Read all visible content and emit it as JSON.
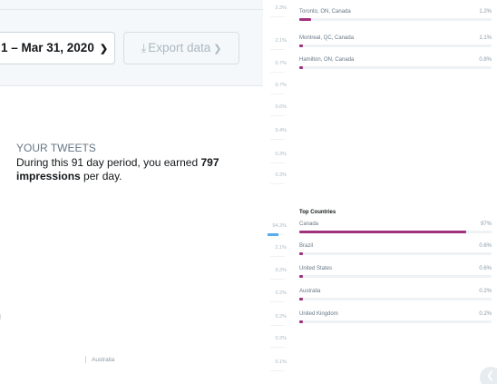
{
  "date_range": {
    "label": "1 – Mar 31, 2020"
  },
  "export": {
    "label": "Export data"
  },
  "tweets": {
    "heading": "YOUR TWEETS",
    "sentence_before": "During this 91 day period, you earned ",
    "impressions_value": "797",
    "impressions_word": "impressions",
    "sentence_after": " per day."
  },
  "left_chart_label": "Australia",
  "percent_column": [
    "2.3%",
    "2.1%",
    "0.7%",
    "0.7%",
    "0.6%",
    "0.4%",
    "0.3%",
    "0.3%",
    "94.3%",
    "2.1%",
    "0.2%",
    "0.2%",
    "0.2%",
    "0.2%",
    "0.1%"
  ],
  "top_cities": [
    {
      "name": "Toronto, ON, Canada",
      "value": "1.2%",
      "fraction": 0.06
    },
    {
      "name": "Montreal, QC, Canada",
      "value": "1.1%",
      "fraction": 0.02
    },
    {
      "name": "Hamilton, ON, Canada",
      "value": "0.8%",
      "fraction": 0.02
    }
  ],
  "top_countries": {
    "title": "Top Countries",
    "items": [
      {
        "name": "Canada",
        "value": "97%",
        "fraction": 0.87
      },
      {
        "name": "Brazil",
        "value": "0.6%",
        "fraction": 0.02
      },
      {
        "name": "United States",
        "value": "0.6%",
        "fraction": 0.02
      },
      {
        "name": "Australia",
        "value": "0.2%",
        "fraction": 0.02
      },
      {
        "name": "United Kingdom",
        "value": "0.2%",
        "fraction": 0.02
      }
    ]
  },
  "colors": {
    "accent_bar": "#a0317f",
    "blue_bar": "#55acee"
  }
}
